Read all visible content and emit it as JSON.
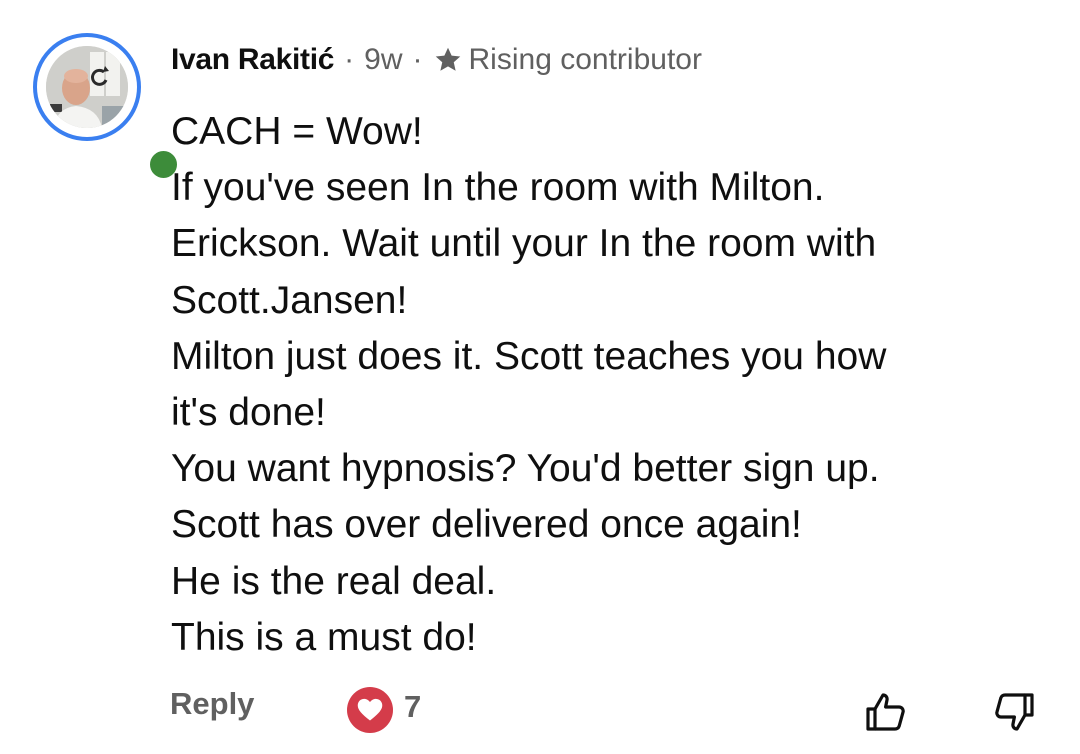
{
  "comment": {
    "author": "Ivan Rakitić",
    "separator": "·",
    "time_ago": "9w",
    "badge_icon": "star-icon",
    "badge_label": "Rising contributor",
    "online": true,
    "body_lines": [
      "CACH = Wow!",
      "If you've seen In the room with Milton.",
      "Erickson. Wait until your In the room with",
      "Scott.Jansen!",
      "Milton just does it. Scott teaches you how",
      "it's done!",
      "You want hypnosis? You'd better sign up.",
      "Scott has over delivered once again!",
      "He is the real deal.",
      "This is a must do!"
    ]
  },
  "actions": {
    "reply_label": "Reply",
    "heart_count": "7",
    "heart_icon": "heart-icon",
    "like_icon": "thumbs-up-icon",
    "dislike_icon": "thumbs-down-icon"
  },
  "colors": {
    "avatar_ring": "#3a7ff0",
    "online_dot": "#3d8c3a",
    "heart_badge": "#d43c4a",
    "secondary_text": "#606060",
    "primary_text": "#0f0f0f"
  }
}
